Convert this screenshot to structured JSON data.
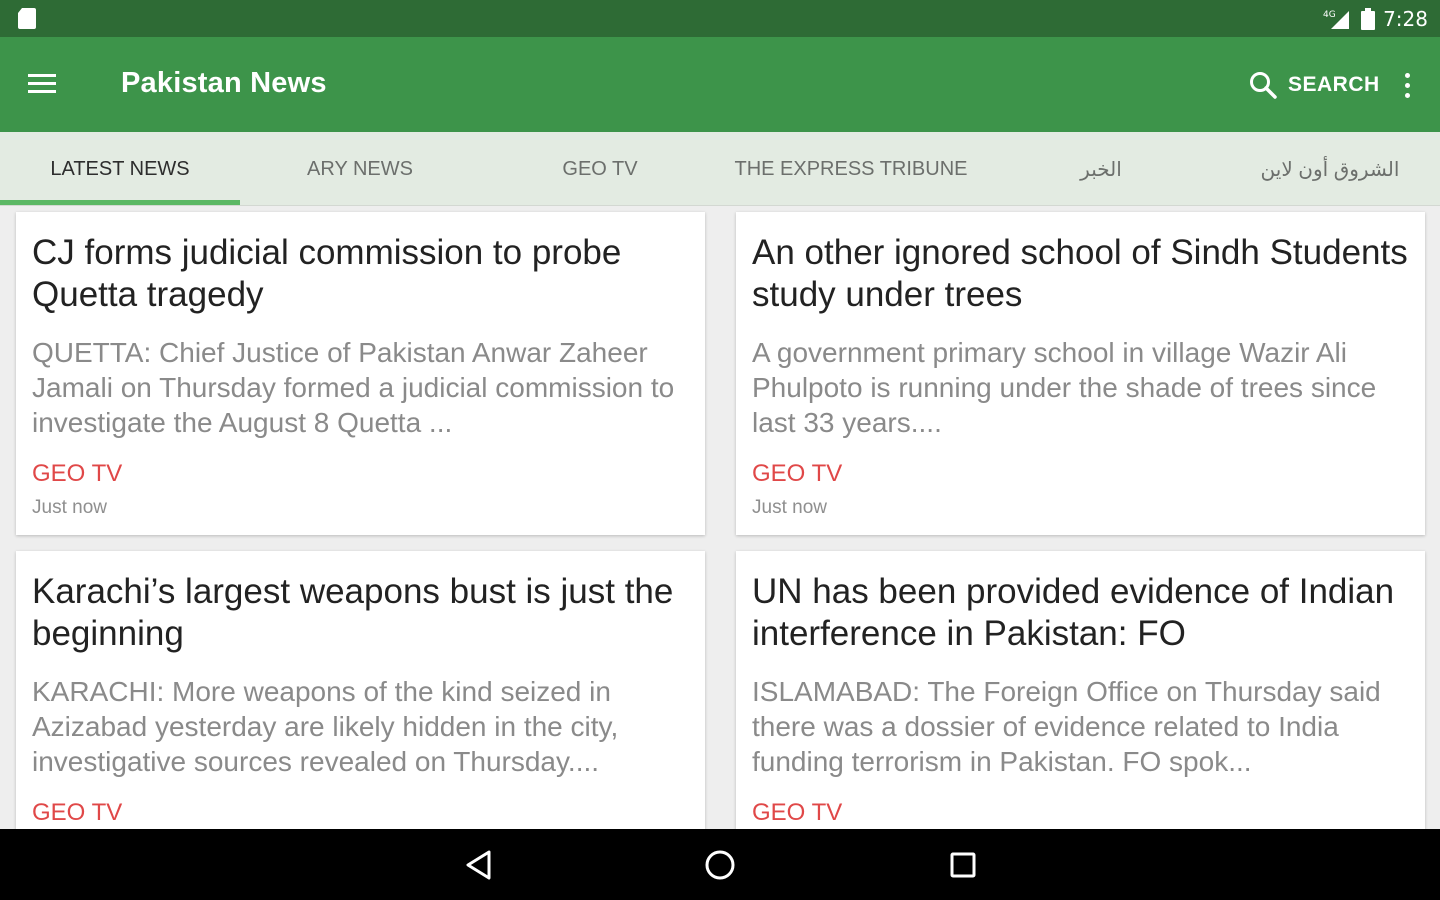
{
  "status_bar": {
    "time": "7:28",
    "network_label": "4G",
    "icons": [
      "sd-card-icon",
      "signal-icon",
      "battery-icon"
    ]
  },
  "app_bar": {
    "title": "Pakistan News",
    "search_label": "SEARCH",
    "icons": [
      "menu-icon",
      "search-icon",
      "overflow-icon"
    ]
  },
  "tabs": [
    {
      "label": "LATEST NEWS",
      "active": true
    },
    {
      "label": "ARY NEWS",
      "active": false
    },
    {
      "label": "GEO TV",
      "active": false
    },
    {
      "label": "THE EXPRESS TRIBUNE",
      "active": false
    },
    {
      "label": "الخبر",
      "active": false
    },
    {
      "label": "الشروق أون لاين",
      "active": false
    }
  ],
  "articles": [
    {
      "title": "CJ forms judicial commission to probe Quetta tragedy",
      "summary": "QUETTA: Chief Justice of Pakistan Anwar Zaheer Jamali on Thursday formed a judicial commission to investigate the August 8 Quetta ...",
      "source": "GEO TV",
      "time": "Just now"
    },
    {
      "title": "An other ignored school of Sindh Students study under trees",
      "summary": "A government primary school in village Wazir Ali Phulpoto is running under the shade of trees since last 33 years....",
      "source": "GEO TV",
      "time": "Just now"
    },
    {
      "title": "Karachi’s largest weapons bust is just the beginning",
      "summary": "KARACHI: More weapons of the kind seized in Azizabad yesterday are likely hidden in the city, investigative sources revealed on Thursday....",
      "source": "GEO TV",
      "time": ""
    },
    {
      "title": "UN has been provided evidence of Indian interference in Pakistan: FO",
      "summary": "ISLAMABAD: The Foreign Office on Thursday said there was a dossier of evidence related to India funding terrorism in Pakistan. FO spok...",
      "source": "GEO TV",
      "time": ""
    }
  ],
  "nav_bar": {
    "icons": [
      "back-icon",
      "home-icon",
      "recents-icon"
    ]
  },
  "colors": {
    "status_bar": "#2e6b35",
    "app_bar": "#3d944a",
    "tab_bar": "#e3ebe2",
    "tab_indicator": "#5cb865",
    "source": "#e04848"
  }
}
